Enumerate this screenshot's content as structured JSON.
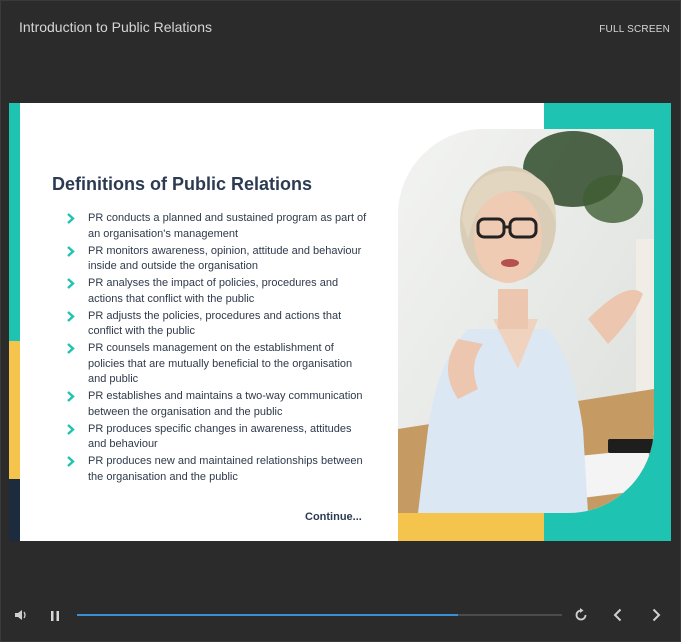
{
  "player": {
    "course_title": "Introduction to Public Relations",
    "fullscreen_label": "FULL SCREEN"
  },
  "slide": {
    "heading": "Definitions of Public Relations",
    "bullets": [
      "PR conducts a planned and sustained program as part of an organisation's management",
      "PR monitors awareness, opinion, attitude and behaviour inside and outside the organisation",
      "PR analyses the impact of policies, procedures and actions that conflict with the public",
      "PR adjusts the policies, procedures and actions that conflict with the public",
      "PR counsels management on the establishment of policies that are mutually beneficial to the organisation and public",
      "PR establishes and maintains a two-way communication between the organisation and the public",
      "PR produces specific changes in awareness, attitudes and behaviour",
      "PR produces new and maintained relationships between the organisation and the public"
    ],
    "continue_label": "Continue..."
  },
  "controls": {
    "progress_fraction": 0.785,
    "icons": [
      "volume-icon",
      "pause-icon",
      "replay-icon",
      "previous-icon",
      "next-icon"
    ]
  },
  "colors": {
    "teal": "#1fc3b2",
    "yellow": "#f5c44c",
    "navy": "#1d2b3f",
    "heading": "#2c3b52",
    "progress": "#3b8fd6",
    "chevron": "#1fc3b2"
  }
}
